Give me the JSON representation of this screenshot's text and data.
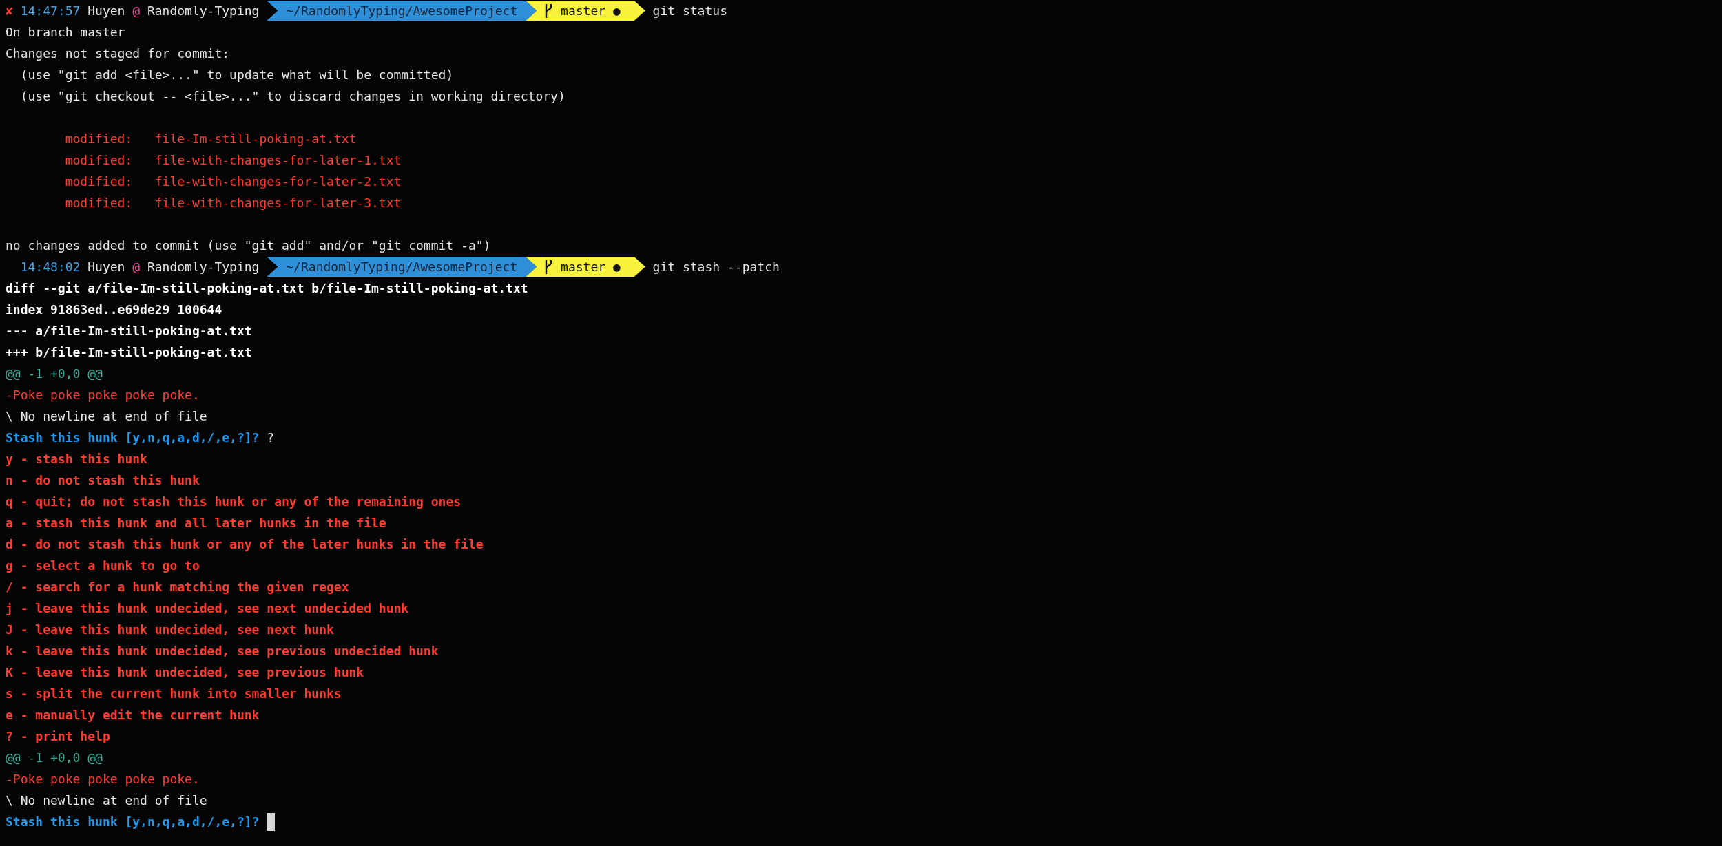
{
  "terminal": {
    "lines": [
      {
        "kind": "prompt",
        "error_mark": "✘",
        "time": "14:47:57",
        "user": "Huyen",
        "at": "@",
        "host": "Randomly-Typing",
        "path": "~/RandomlyTyping/AwesomeProject",
        "branch": "master",
        "dirty": "●",
        "command": "git status"
      },
      {
        "kind": "plain",
        "text": "On branch master"
      },
      {
        "kind": "plain",
        "text": "Changes not staged for commit:"
      },
      {
        "kind": "hint",
        "text": "(use \"git add <file>...\" to update what will be committed)"
      },
      {
        "kind": "hint",
        "text": "(use \"git checkout -- <file>...\" to discard changes in working directory)"
      },
      {
        "kind": "blank"
      },
      {
        "kind": "modified",
        "label": "modified:",
        "file": "file-Im-still-poking-at.txt"
      },
      {
        "kind": "modified",
        "label": "modified:",
        "file": "file-with-changes-for-later-1.txt"
      },
      {
        "kind": "modified",
        "label": "modified:",
        "file": "file-with-changes-for-later-2.txt"
      },
      {
        "kind": "modified",
        "label": "modified:",
        "file": "file-with-changes-for-later-3.txt"
      },
      {
        "kind": "blank"
      },
      {
        "kind": "plain",
        "text": "no changes added to commit (use \"git add\" and/or \"git commit -a\")"
      },
      {
        "kind": "prompt",
        "time": "14:48:02",
        "user": "Huyen",
        "at": "@",
        "host": "Randomly-Typing",
        "path": "~/RandomlyTyping/AwesomeProject",
        "branch": "master",
        "dirty": "●",
        "command": "git stash --patch"
      },
      {
        "kind": "header",
        "text": "diff --git a/file-Im-still-poking-at.txt b/file-Im-still-poking-at.txt"
      },
      {
        "kind": "header",
        "text": "index 91863ed..e69de29 100644"
      },
      {
        "kind": "header",
        "text": "--- a/file-Im-still-poking-at.txt"
      },
      {
        "kind": "header",
        "text": "+++ b/file-Im-still-poking-at.txt"
      },
      {
        "kind": "hunk",
        "text": "@@ -1 +0,0 @@"
      },
      {
        "kind": "removed",
        "text": "-Poke poke poke poke poke."
      },
      {
        "kind": "plain",
        "text": "\\ No newline at end of file"
      },
      {
        "kind": "question",
        "text": "Stash this hunk [y,n,q,a,d,/,e,?]?",
        "answer": "?"
      },
      {
        "kind": "help",
        "text": "y - stash this hunk"
      },
      {
        "kind": "help",
        "text": "n - do not stash this hunk"
      },
      {
        "kind": "help",
        "text": "q - quit; do not stash this hunk or any of the remaining ones"
      },
      {
        "kind": "help",
        "text": "a - stash this hunk and all later hunks in the file"
      },
      {
        "kind": "help",
        "text": "d - do not stash this hunk or any of the later hunks in the file"
      },
      {
        "kind": "help",
        "text": "g - select a hunk to go to"
      },
      {
        "kind": "help",
        "text": "/ - search for a hunk matching the given regex"
      },
      {
        "kind": "help",
        "text": "j - leave this hunk undecided, see next undecided hunk"
      },
      {
        "kind": "help",
        "text": "J - leave this hunk undecided, see next hunk"
      },
      {
        "kind": "help",
        "text": "k - leave this hunk undecided, see previous undecided hunk"
      },
      {
        "kind": "help",
        "text": "K - leave this hunk undecided, see previous hunk"
      },
      {
        "kind": "help",
        "text": "s - split the current hunk into smaller hunks"
      },
      {
        "kind": "help",
        "text": "e - manually edit the current hunk"
      },
      {
        "kind": "help",
        "text": "? - print help"
      },
      {
        "kind": "hunk",
        "text": "@@ -1 +0,0 @@"
      },
      {
        "kind": "removed",
        "text": "-Poke poke poke poke poke."
      },
      {
        "kind": "plain",
        "text": "\\ No newline at end of file"
      },
      {
        "kind": "question",
        "text": "Stash this hunk [y,n,q,a,d,/,e,?]?",
        "cursor": true
      }
    ]
  }
}
